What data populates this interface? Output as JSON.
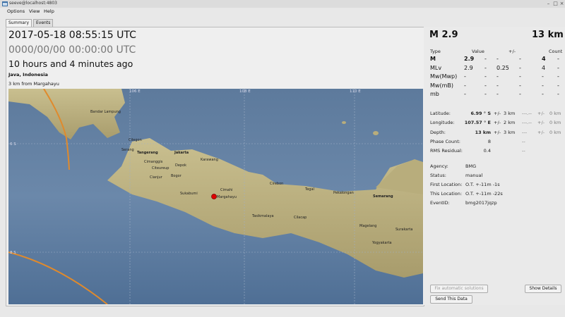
{
  "window": {
    "title": "seeve@localhost:4803"
  },
  "menu": {
    "options": "Options",
    "view": "View",
    "help": "Help"
  },
  "tabs": {
    "summary": "Summary",
    "events": "Events"
  },
  "summary": {
    "origin_time": "2017-05-18 08:55:15 UTC",
    "local_time": "0000/00/00  00:00:00 UTC",
    "time_ago": "10 hours and 4 minutes ago",
    "region": "Java, Indonesia",
    "nearest": "3 km from Margahayu"
  },
  "map": {
    "lon_labels": [
      "106 E",
      "108 E",
      "110 E"
    ],
    "lat_label": "6 S",
    "lat_label2": "8 S",
    "cities": [
      "Bandar Lampung",
      "Cilegon",
      "Serang",
      "Tangerang",
      "Jakarta",
      "Depok",
      "Karawang",
      "Cimanggis",
      "Citeureup",
      "Bogor",
      "Cianjur",
      "Sukabumi",
      "Cimahi",
      "Margahayu",
      "Cirebon",
      "Tegal",
      "Pekalongan",
      "Semarang",
      "Tasikmalaya",
      "Cilacap",
      "Magelang",
      "Surakarta",
      "Yogyakarta"
    ]
  },
  "right": {
    "magnitude": "M 2.9",
    "depth_head": "13 km",
    "table_head": {
      "type": "Type",
      "value": "Value",
      "pm": "+/-",
      "count": "Count"
    },
    "mags": [
      {
        "type": "M",
        "value": "2.9",
        "pm": "-",
        "c1": "-",
        "c2": "-",
        "count": "4",
        "dash": "-"
      },
      {
        "type": "MLv",
        "value": "2.9",
        "pm": "0.25",
        "c1": "-",
        "c2": "-",
        "count": "4",
        "dash": "-"
      },
      {
        "type": "Mw(Mwp)",
        "value": "-",
        "pm": "-",
        "c1": "-",
        "c2": "-",
        "count": "-",
        "dash": "-"
      },
      {
        "type": "Mw(mB)",
        "value": "-",
        "pm": "-",
        "c1": "-",
        "c2": "-",
        "count": "-",
        "dash": "-"
      },
      {
        "type": "mb",
        "value": "-",
        "pm": "-",
        "c1": "-",
        "c2": "-",
        "count": "-",
        "dash": "-"
      }
    ],
    "location": [
      {
        "label": "Latitude:",
        "value": "6.99 ° S",
        "pm": "+/-",
        "err": "3 km",
        "x1": "---.--",
        "x2": "+/-",
        "x3": "0 km"
      },
      {
        "label": "Longitude:",
        "value": "107.57 ° E",
        "pm": "+/-",
        "err": "2 km",
        "x1": "---.--",
        "x2": "+/-",
        "x3": "0 km"
      },
      {
        "label": "Depth:",
        "value": "13 km",
        "pm": "+/-",
        "err": "3 km",
        "x1": "---",
        "x2": "+/-",
        "x3": "0 km"
      },
      {
        "label": "Phase Count:",
        "value": "8",
        "pm": "",
        "err": "",
        "x1": "--",
        "x2": "",
        "x3": ""
      },
      {
        "label": "RMS Residual:",
        "value": "0.4",
        "pm": "",
        "err": "",
        "x1": "--",
        "x2": "",
        "x3": ""
      }
    ],
    "info": [
      {
        "label": "Agency:",
        "value": "BMG"
      },
      {
        "label": "Status:",
        "value": "manual"
      },
      {
        "label": "First Location:",
        "value": "O.T. +-11m -1s"
      },
      {
        "label": "This Location:",
        "value": "O.T. +-11m -22s"
      },
      {
        "label": "EventID:",
        "value": "bmg2017jqzp"
      }
    ],
    "buttons": {
      "fix": "Fix automatic solutions",
      "show": "Show Details",
      "send": "Send This Data"
    }
  }
}
